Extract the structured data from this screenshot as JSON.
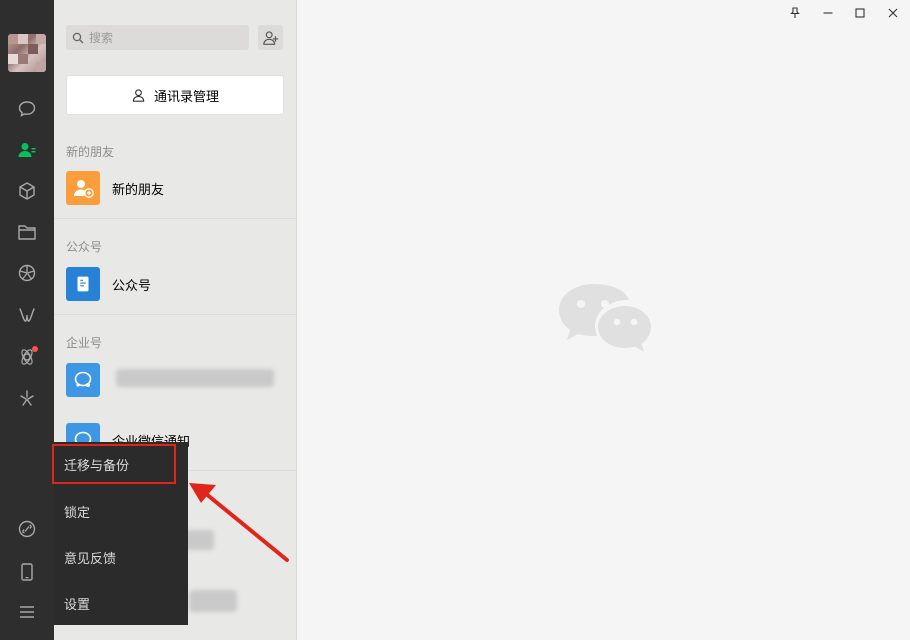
{
  "sidebar": {
    "icons": [
      "chat-icon",
      "contacts-icon",
      "cube-icon",
      "folder-icon",
      "moments-icon",
      "mini-program-icon",
      "search-apps-icon",
      "flash-icon",
      "link-icon",
      "phone-icon",
      "menu-icon"
    ],
    "active_color": "#07c160"
  },
  "search": {
    "placeholder": "搜索"
  },
  "contacts": {
    "manage_label": "通讯录管理",
    "sections": [
      {
        "title": "新的朋友",
        "items": [
          {
            "label": "新的朋友",
            "icon": "new-friend-icon",
            "color": "#fa9d3b"
          }
        ]
      },
      {
        "title": "公众号",
        "items": [
          {
            "label": "公众号",
            "icon": "official-account-icon",
            "color": "#2782d7"
          }
        ]
      },
      {
        "title": "企业号",
        "items": [
          {
            "label": "",
            "icon": "enterprise-icon",
            "color": "#3e97e5"
          },
          {
            "label": "企业微信通知",
            "icon": "enterprise-notify-icon",
            "color": "#3e97e5"
          }
        ]
      }
    ]
  },
  "menu": {
    "items": [
      "迁移与备份",
      "锁定",
      "意见反馈",
      "设置"
    ],
    "highlight_color": "#e1251b"
  },
  "window": {
    "controls": [
      "pin-icon",
      "minimize-icon",
      "maximize-icon",
      "close-icon"
    ]
  },
  "colors": {
    "arrow": "#e1251b",
    "logo": "#dcdcdc"
  }
}
